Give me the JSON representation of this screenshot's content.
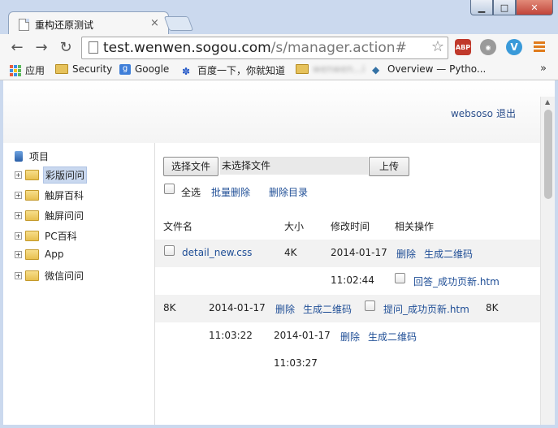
{
  "window": {
    "tab_title": "重构还原测试",
    "tab_close": "×",
    "buttons": {
      "minimize": "▁",
      "maximize": "□",
      "close": "✕"
    }
  },
  "toolbar": {
    "url_host": "test.wenwen.sogou.com",
    "url_path": "/s/manager.action#",
    "icons": [
      "back-icon",
      "forward-icon",
      "reload-icon",
      "page-icon",
      "star-icon",
      "adblock-icon",
      "globe-icon",
      "extension-v-icon",
      "menu-icon"
    ],
    "abp_label": "ABP",
    "v_label": "V"
  },
  "bookmarks": {
    "items": [
      {
        "label": "应用",
        "icon": "apps-icon"
      },
      {
        "label": "Security",
        "icon": "folder-icon"
      },
      {
        "label": "Google",
        "icon": "google-icon"
      },
      {
        "label": "百度一下，你就知道",
        "icon": "baidu-paw-icon"
      },
      {
        "label": "wenwen...i",
        "icon": "folder-icon"
      },
      {
        "label": "Overview — Pytho...",
        "icon": "python-icon"
      }
    ],
    "more": "»"
  },
  "header": {
    "user": "websoso",
    "logout": "退出"
  },
  "tree": {
    "root": "项目",
    "items": [
      {
        "label": "彩版问问",
        "selected": true
      },
      {
        "label": "触屏百科",
        "selected": false
      },
      {
        "label": "触屏问问",
        "selected": false
      },
      {
        "label": "PC百科",
        "selected": false
      },
      {
        "label": "App",
        "selected": false
      },
      {
        "label": "微信问问",
        "selected": false
      }
    ]
  },
  "upload": {
    "choose_button": "选择文件",
    "no_file": "未选择文件",
    "upload_button": "上传"
  },
  "actions": {
    "select_all": "全选",
    "batch_delete": "批量删除",
    "delete_dir": "删除目录"
  },
  "table": {
    "headers": [
      "文件名",
      "大小",
      "修改时间",
      "相关操作"
    ],
    "row1": {
      "name": "detail_new.css",
      "size": "4K",
      "date": "2014-01-17",
      "time": "11:02:44",
      "delete": "删除",
      "qrcode": "生成二维码"
    },
    "row2": {
      "name": "回答_成功页新.htm",
      "size": "8K",
      "date": "2014-01-17",
      "time": "11:03:22",
      "delete": "删除",
      "qrcode": "生成二维码"
    },
    "row3": {
      "name": "提问_成功页新.htm",
      "size": "8K",
      "date": "2014-01-17",
      "time": "11:03:27",
      "delete": "删除",
      "qrcode": "生成二维码"
    }
  },
  "colors": {
    "link": "#1f4e96",
    "frame": "#cbd9ee",
    "accent_orange": "#e07b1c"
  }
}
